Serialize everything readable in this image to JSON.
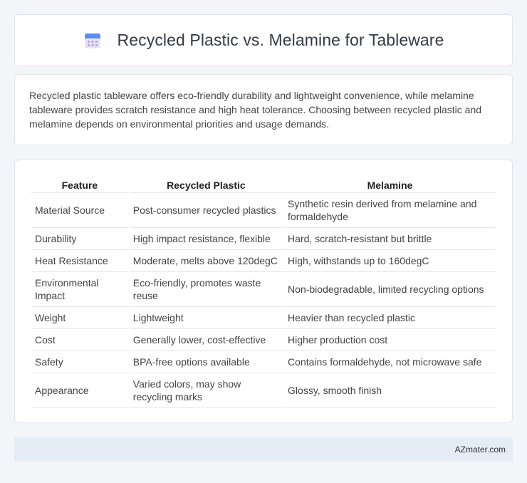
{
  "header": {
    "title": "Recycled Plastic vs. Melamine for Tableware",
    "icon": "calendar-icon"
  },
  "intro": {
    "text": "Recycled plastic tableware offers eco-friendly durability and lightweight convenience, while melamine tableware provides scratch resistance and high heat tolerance. Choosing between recycled plastic and melamine depends on environmental priorities and usage demands."
  },
  "table": {
    "headers": [
      "Feature",
      "Recycled Plastic",
      "Melamine"
    ],
    "rows": [
      [
        "Material Source",
        "Post-consumer recycled plastics",
        "Synthetic resin derived from melamine and formaldehyde"
      ],
      [
        "Durability",
        "High impact resistance, flexible",
        "Hard, scratch-resistant but brittle"
      ],
      [
        "Heat Resistance",
        "Moderate, melts above 120degC",
        "High, withstands up to 160degC"
      ],
      [
        "Environmental Impact",
        "Eco-friendly, promotes waste reuse",
        "Non-biodegradable, limited recycling options"
      ],
      [
        "Weight",
        "Lightweight",
        "Heavier than recycled plastic"
      ],
      [
        "Cost",
        "Generally lower, cost-effective",
        "Higher production cost"
      ],
      [
        "Safety",
        "BPA-free options available",
        "Contains formaldehyde, not microwave safe"
      ],
      [
        "Appearance",
        "Varied colors, may show recycling marks",
        "Glossy, smooth finish"
      ]
    ]
  },
  "footer": {
    "brand": "AZmater.com"
  }
}
